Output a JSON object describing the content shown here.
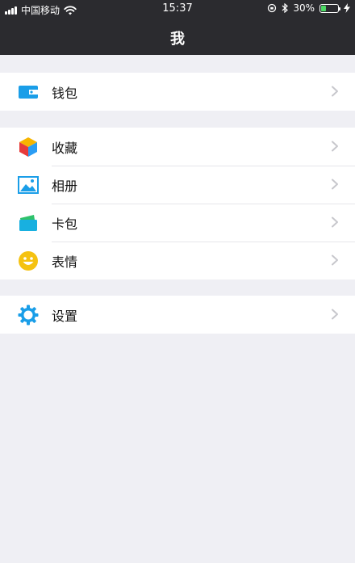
{
  "status_bar": {
    "carrier": "中国移动",
    "time": "15:37",
    "battery_percent": "30%",
    "battery_level": 0.3
  },
  "nav": {
    "title": "我"
  },
  "groups": [
    {
      "items": [
        {
          "label": "钱包",
          "icon": "wallet-icon"
        }
      ]
    },
    {
      "items": [
        {
          "label": "收藏",
          "icon": "favorites-cube-icon"
        },
        {
          "label": "相册",
          "icon": "photo-album-icon"
        },
        {
          "label": "卡包",
          "icon": "card-pack-icon"
        },
        {
          "label": "表情",
          "icon": "emoji-smile-icon"
        }
      ]
    },
    {
      "items": [
        {
          "label": "设置",
          "icon": "settings-gear-icon"
        }
      ]
    }
  ],
  "colors": {
    "header_bg": "#2b2b2f",
    "page_bg": "#efeff4",
    "accent_blue": "#1a9ee8",
    "emoji_yellow": "#f5c211",
    "battery_green": "#4cd964"
  }
}
